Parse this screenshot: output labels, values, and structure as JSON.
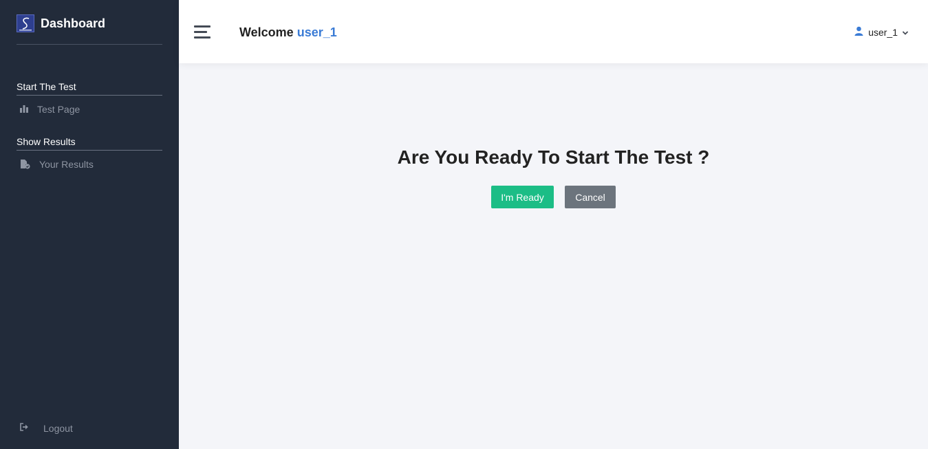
{
  "sidebar": {
    "brand_title": "Dashboard",
    "sections": [
      {
        "title": "Start The Test",
        "items": [
          {
            "label": "Test Page",
            "icon": "bar-chart-icon"
          }
        ]
      },
      {
        "title": "Show Results",
        "items": [
          {
            "label": "Your Results",
            "icon": "file-check-icon"
          }
        ]
      }
    ],
    "logout_label": "Logout"
  },
  "header": {
    "welcome_label": "Welcome",
    "username": "user_1",
    "user_menu_label": "user_1"
  },
  "main": {
    "prompt": "Are You Ready To Start The Test ?",
    "ready_button": "I'm Ready",
    "cancel_button": "Cancel"
  },
  "colors": {
    "sidebar_bg": "#222b3a",
    "accent_blue": "#3a7bd5",
    "ready_green": "#1cbd86",
    "cancel_gray": "#6c747d",
    "page_bg": "#f4f5f9"
  }
}
